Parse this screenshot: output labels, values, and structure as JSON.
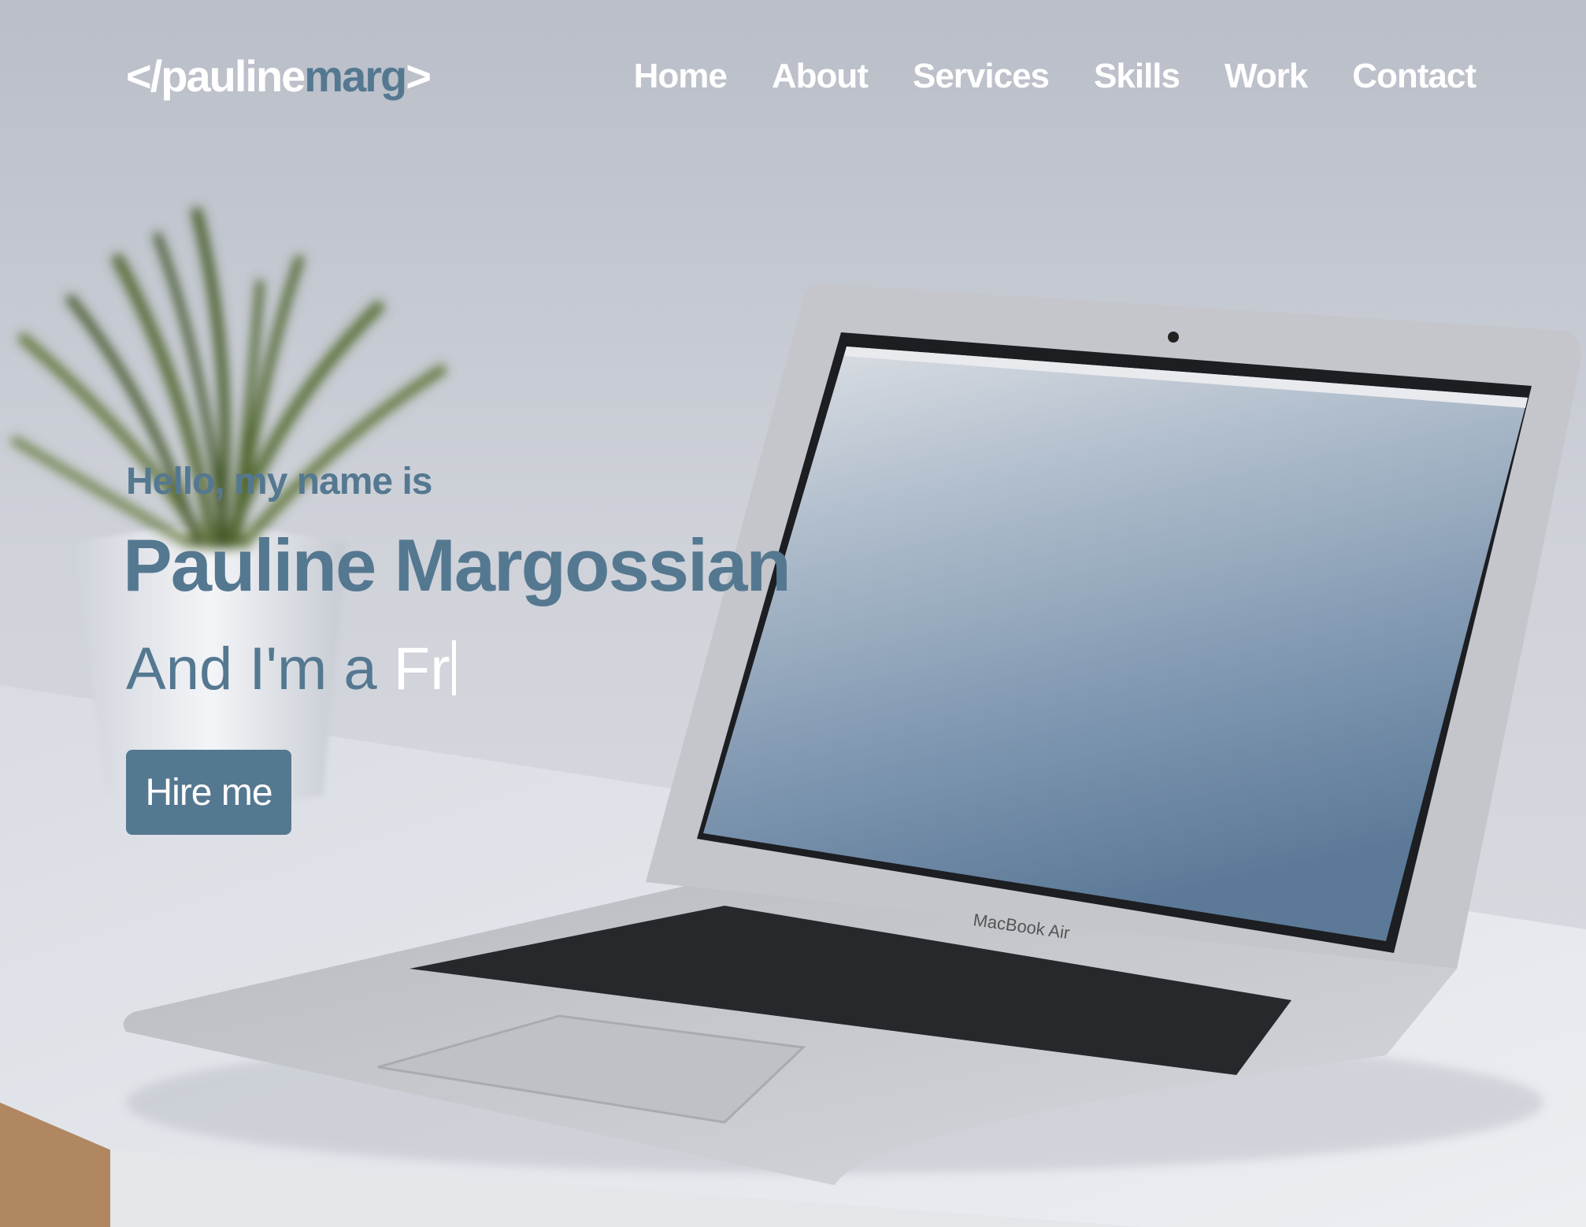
{
  "logo": {
    "prefix": "</pauline",
    "accent": "marg",
    "suffix": ">"
  },
  "nav": {
    "items": [
      {
        "label": "Home"
      },
      {
        "label": "About"
      },
      {
        "label": "Services"
      },
      {
        "label": "Skills"
      },
      {
        "label": "Work"
      },
      {
        "label": "Contact"
      }
    ]
  },
  "hero": {
    "greeting": "Hello, my name is",
    "name": "Pauline Margossian",
    "tagline_prefix": "And I'm a ",
    "tagline_typed": "Fr",
    "button_label": "Hire me"
  },
  "laptop": {
    "brand_label": "MacBook Air"
  },
  "colors": {
    "accent": "#557891",
    "nav_text": "#ffffff"
  },
  "icons": {
    "plant": "potted-plant-photo",
    "laptop": "laptop-photo"
  }
}
